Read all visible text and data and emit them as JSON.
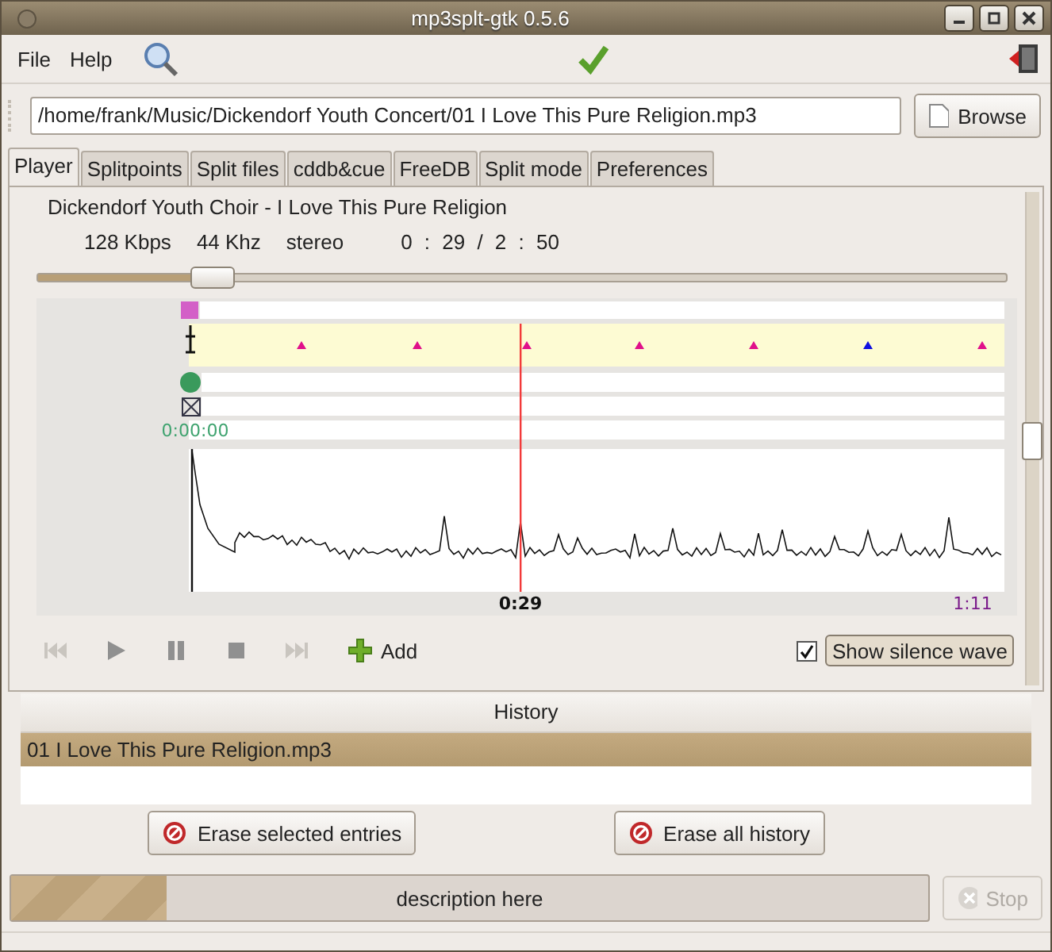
{
  "window": {
    "title": "mp3splt-gtk 0.5.6"
  },
  "menu": [
    {
      "label": "File"
    },
    {
      "label": "Help"
    }
  ],
  "file_path": {
    "value": "/home/frank/Music/Dickendorf Youth Concert/01 I Love This Pure Religion.mp3"
  },
  "browse_button": {
    "label": "Browse"
  },
  "tabs": [
    {
      "label": "Player",
      "selected": true
    },
    {
      "label": "Splitpoints",
      "selected": false
    },
    {
      "label": "Split files",
      "selected": false
    },
    {
      "label": "cddb&cue",
      "selected": false
    },
    {
      "label": "FreeDB",
      "selected": false
    },
    {
      "label": "Split mode",
      "selected": false
    },
    {
      "label": "Preferences",
      "selected": false
    }
  ],
  "player": {
    "song_title": "Dickendorf Youth Choir - I Love This Pure Religion",
    "bitrate": "128 Kbps",
    "frequency": "44 Khz",
    "mode": "stereo",
    "time": "0 : 29 / 2 : 50",
    "seek": {
      "level": 0.18
    },
    "timeline": {
      "start_time": "0:00:00",
      "cursor_time": "0:29",
      "end_time": "1:11"
    },
    "controls": [
      {
        "kind": "previous",
        "disabled": true
      },
      {
        "kind": "play",
        "disabled": false
      },
      {
        "kind": "pause",
        "disabled": false
      },
      {
        "kind": "stop",
        "disabled": false
      },
      {
        "kind": "next",
        "disabled": true
      }
    ],
    "add_button": {
      "label": "Add"
    },
    "silence_wave": {
      "label": "Show silence wave",
      "checked": true
    }
  },
  "history": {
    "header": "History",
    "rows": [
      {
        "name": "01 I Love This Pure Religion.mp3",
        "selected": true
      }
    ],
    "buttons": [
      {
        "label": "Erase selected entries"
      },
      {
        "label": "Erase all history"
      }
    ]
  },
  "status": {
    "description": "description here",
    "level": 0.17,
    "stop_button": {
      "label": "Stop",
      "disabled": true
    }
  }
}
